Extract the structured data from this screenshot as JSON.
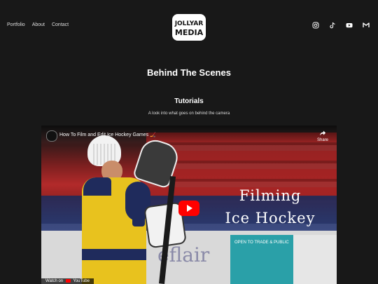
{
  "nav": {
    "items": [
      "Portfolio",
      "About",
      "Contact"
    ]
  },
  "logo": {
    "text_line1": "JOLLYAR",
    "text_line2": "MEDIA"
  },
  "social": [
    "instagram-icon",
    "tiktok-icon",
    "youtube-icon",
    "mail-icon"
  ],
  "page": {
    "title": "Behind The Scenes",
    "section_title": "Tutorials",
    "section_subtitle": "A look into what goes on behind the camera"
  },
  "video": {
    "title": "How To Film and Edit Ice Hockey Games 🏒",
    "share_label": "Share",
    "overlay_line1": "Filming",
    "overlay_line2": "Ice Hockey",
    "watch_on": "Watch on",
    "youtube_label": "YouTube",
    "sign_text": "eflair",
    "banner_text": "OPEN TO TRADE & PUBLIC"
  },
  "colors": {
    "background": "#181818",
    "youtube_red": "#ff0000",
    "jersey_yellow": "#e8c21e",
    "jersey_navy": "#1f2b5c"
  }
}
